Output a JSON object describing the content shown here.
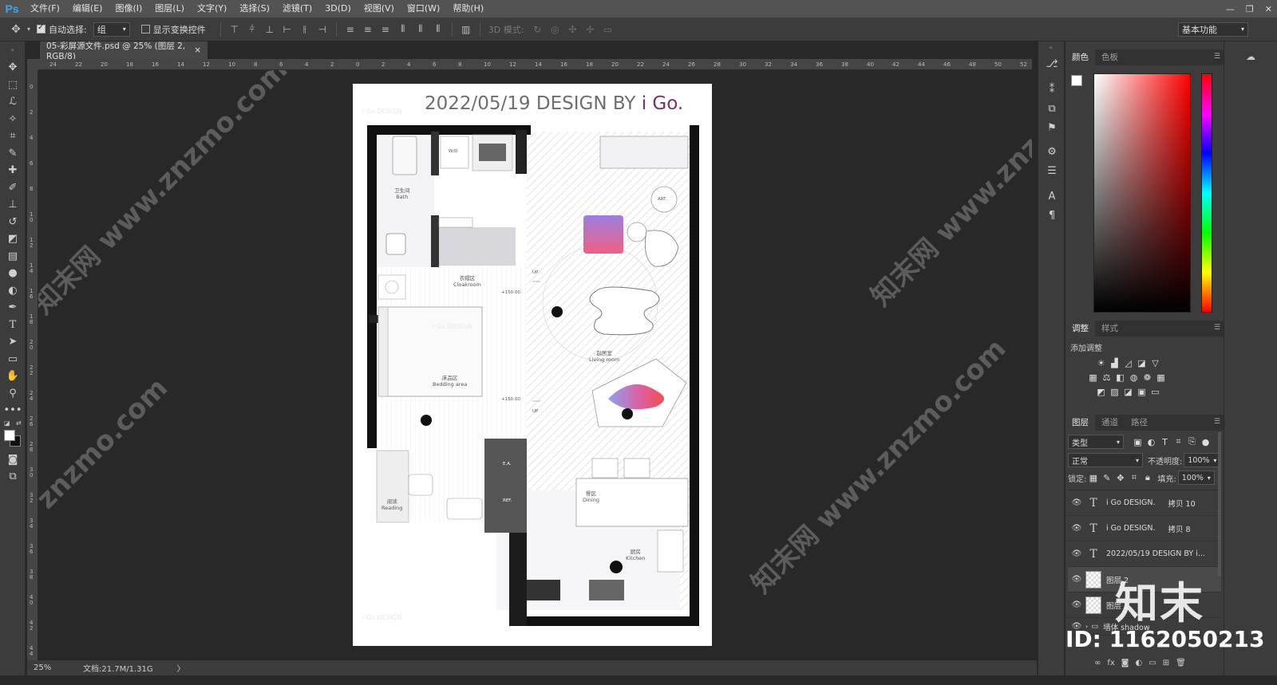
{
  "app": {
    "logo": "Ps"
  },
  "menu": [
    "文件(F)",
    "编辑(E)",
    "图像(I)",
    "图层(L)",
    "文字(Y)",
    "选择(S)",
    "滤镜(T)",
    "3D(D)",
    "视图(V)",
    "窗口(W)",
    "帮助(H)"
  ],
  "window_controls": [
    "—",
    "❐",
    "✕"
  ],
  "options": {
    "auto_select_label": "自动选择:",
    "auto_select_value": "组",
    "show_transform_label": "显示变换控件",
    "mode_3d_label": "3D 模式:",
    "workspace": "基本功能"
  },
  "document_tab": {
    "title": "05-彩屏源文件.psd @ 25% (图层 2, RGB/8)",
    "close": "×"
  },
  "ruler_h": [
    "24",
    "22",
    "20",
    "18",
    "16",
    "14",
    "12",
    "10",
    "8",
    "6",
    "4",
    "2",
    "0",
    "2",
    "4",
    "6",
    "8",
    "10",
    "12",
    "14",
    "16",
    "18",
    "20",
    "22",
    "24",
    "26",
    "28",
    "30",
    "32",
    "34",
    "36",
    "38",
    "40",
    "42",
    "44",
    "46",
    "48",
    "50",
    "52"
  ],
  "ruler_v": [
    "0",
    "2",
    "4",
    "6",
    "8",
    "1 0",
    "1 2",
    "1 4",
    "1 6",
    "1 8",
    "2 0",
    "2 2",
    "2 4",
    "2 6",
    "2 8",
    "3 0",
    "3 2",
    "3 4",
    "3 6",
    "3 8",
    "4 0",
    "4 2",
    "4 4"
  ],
  "plan": {
    "title_main": "2022/05/19 DESIGN  BY ",
    "title_brand": "i Go.",
    "watermark_text": "i Go DESIGN",
    "rooms": [
      {
        "cn": "卫生间",
        "en": "Bath"
      },
      {
        "cn": "衣帽区",
        "en": "Cloakroom"
      },
      {
        "cn": "床品区",
        "en": "Bedding area"
      },
      {
        "cn": "起居室",
        "en": "Living room"
      },
      {
        "cn": "阅读",
        "en": "Reading"
      },
      {
        "cn": "餐区",
        "en": "Dining"
      },
      {
        "cn": "厨房",
        "en": "Kitchen"
      }
    ],
    "labels": {
      "wd": "W/D",
      "art": "ART.",
      "up1": "UP",
      "up2": "UP",
      "elev1": "+150.00",
      "elev2": "+150.00",
      "ea": "E.A.",
      "ref": "REF."
    }
  },
  "status": {
    "zoom": "25%",
    "doc_info": "文档:21.7M/1.31G",
    "arrow": "〉"
  },
  "panels": {
    "color_tabs": [
      "颜色",
      "色板"
    ],
    "adjust_tabs": [
      "调整",
      "样式"
    ],
    "add_adjustment": "添加调整",
    "layer_tabs": [
      "图层",
      "通道",
      "路径"
    ],
    "filter_kind": "类型",
    "blend_mode": "正常",
    "opacity_label": "不透明度:",
    "opacity_value": "100%",
    "lock_label": "锁定:",
    "fill_label": "填充:",
    "fill_value": "100%",
    "layers": [
      {
        "type": "text",
        "name": "i Go DESIGN.",
        "suffix": "拷贝 10"
      },
      {
        "type": "text",
        "name": "i Go DESIGN.",
        "suffix": "拷贝 8"
      },
      {
        "type": "text",
        "name": "2022/05/19 DESIGN  BY i...",
        "suffix": ""
      },
      {
        "type": "pixel",
        "name": "图层 2",
        "suffix": ""
      },
      {
        "type": "pixel",
        "name": "图层 1",
        "suffix": ""
      },
      {
        "type": "group",
        "name": "墙体 shadow",
        "suffix": ""
      }
    ]
  },
  "watermarks": [
    "知末网 www.znzmo.com",
    "知末网 www.znzmo.com",
    "知末网 www.znzmo.com",
    "znzmo.com"
  ],
  "brand": {
    "logo": "知末",
    "id": "ID: 1162050213"
  },
  "colors": {
    "menubar": "#535353",
    "panel": "#3c3c3c",
    "canvas_bg": "#282828",
    "accent_title": "#7a2f6e",
    "ps_blue": "#31a8ff"
  }
}
